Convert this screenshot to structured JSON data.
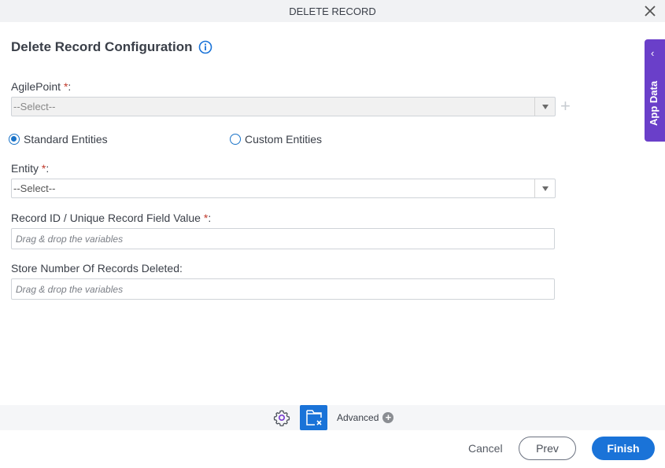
{
  "dialog": {
    "title": "DELETE RECORD"
  },
  "form": {
    "heading": "Delete Record Configuration",
    "agilepoint": {
      "label": "AgilePoint ",
      "required_mark": "*",
      "colon": ":",
      "value": "--Select--",
      "disabled": true
    },
    "entity_type": {
      "options": [
        {
          "label": "Standard Entities",
          "checked": true
        },
        {
          "label": "Custom Entities",
          "checked": false
        }
      ]
    },
    "entity": {
      "label": "Entity ",
      "required_mark": "*",
      "colon": ":",
      "value": "--Select--"
    },
    "record_id": {
      "label": "Record ID / Unique Record Field Value ",
      "required_mark": "*",
      "colon": ":",
      "placeholder": "Drag & drop the variables"
    },
    "store_count": {
      "label": "Store Number Of Records Deleted:",
      "placeholder": "Drag & drop the variables"
    }
  },
  "side_panel": {
    "label": "App Data",
    "color": "#6a3fc9"
  },
  "toolbar": {
    "advanced_label": "Advanced"
  },
  "footer": {
    "cancel": "Cancel",
    "prev": "Prev",
    "finish": "Finish",
    "accent": "#1a73d8"
  }
}
